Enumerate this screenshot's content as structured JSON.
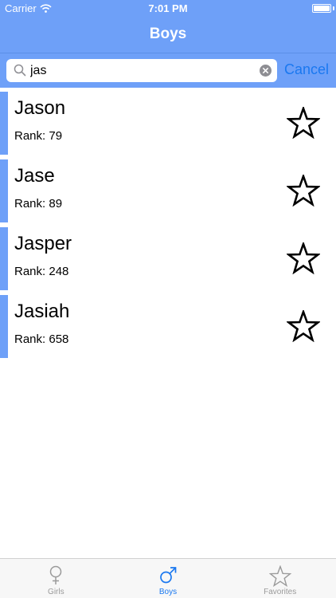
{
  "status_bar": {
    "carrier": "Carrier",
    "time": "7:01 PM"
  },
  "nav": {
    "title": "Boys"
  },
  "search": {
    "value": "jas",
    "cancel_label": "Cancel"
  },
  "results": [
    {
      "name": "Jason",
      "rank": "Rank: 79"
    },
    {
      "name": "Jase",
      "rank": "Rank: 89"
    },
    {
      "name": "Jasper",
      "rank": "Rank: 248"
    },
    {
      "name": "Jasiah",
      "rank": "Rank: 658"
    }
  ],
  "tabs": [
    {
      "label": "Girls",
      "icon": "female-symbol-icon"
    },
    {
      "label": "Boys",
      "icon": "male-symbol-icon"
    },
    {
      "label": "Favorites",
      "icon": "star-icon"
    }
  ],
  "colors": {
    "accent": "#6ea0f8",
    "link": "#1a78f0",
    "inactive": "#9a9a9a"
  }
}
